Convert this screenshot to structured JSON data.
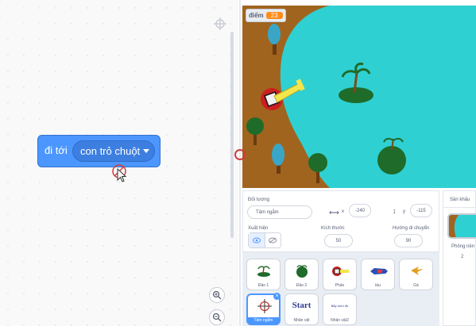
{
  "code": {
    "block": {
      "label": "đi tới",
      "dropdown_value": "con trỏ chuột"
    }
  },
  "stage": {
    "score_label": "điểm",
    "score_value": "23"
  },
  "sprite_info": {
    "sprite_label": "Đối tượng",
    "sprite_name": "Tâm ngắm",
    "x_label": "x",
    "x_value": "-240",
    "y_label": "y",
    "y_value": "-115",
    "show_label": "Xuất hiện",
    "size_label": "Kích thước",
    "size_value": "50",
    "direction_label": "Hướng di chuyển",
    "direction_value": "90"
  },
  "sprites": [
    {
      "name": "Đảo 1"
    },
    {
      "name": "Đảo 2"
    },
    {
      "name": "Pháo"
    },
    {
      "name": "tàu"
    },
    {
      "name": "Gà"
    },
    {
      "name": "Tâm ngắm",
      "selected": true
    },
    {
      "name": "Nhân vật",
      "icon_text": "Start"
    },
    {
      "name": "Nhân vật2",
      "icon_text": "Bẫy mức độ"
    }
  ],
  "stage_selector": {
    "title": "Sân khấu",
    "backdrops_label": "Phông nền",
    "backdrops_count": "2"
  },
  "colors": {
    "block_blue": "#4c97ff",
    "water": "#2fd0d2",
    "land": "#a0641e",
    "score_badge": "#ff8c1a"
  }
}
